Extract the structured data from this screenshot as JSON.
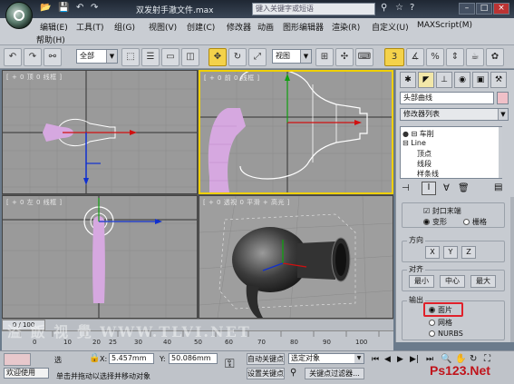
{
  "window": {
    "title": "双发射手澈文件.max",
    "search_placeholder": "键入关键字或短语"
  },
  "menu": {
    "row1": [
      "编辑(E)",
      "工具(T)",
      "组(G)",
      "视图(V)",
      "创建(C)",
      "修改器",
      "动画",
      "图形编辑器",
      "渲染(R)",
      "自定义(U)",
      "MAXScript(M)"
    ],
    "row2": [
      "帮助(H)"
    ]
  },
  "toolbar": {
    "selection_filter": "全部",
    "reference_coord": "视图",
    "snap_value": "3"
  },
  "viewports": {
    "top": "[ + 0 顶 0 线框 ]",
    "front": "[ + 0 前 0 线框 ]",
    "left": "[ + 0 左 0 线框 ]",
    "perspective": "[ + 0 透视 0 平滑 + 高光 ]"
  },
  "panel": {
    "object_name": "头部曲线",
    "modifier_list": "修改器列表",
    "stack": {
      "top": "车削",
      "base": "Line",
      "sub1": "顶点",
      "sub2": "线段",
      "sub3": "样条线"
    },
    "cap_end": "封口末端",
    "morph": "变形",
    "grid": "栅格",
    "direction": {
      "title": "方向",
      "x": "X",
      "y": "Y",
      "z": "Z"
    },
    "align": {
      "title": "对齐",
      "min": "最小",
      "center": "中心",
      "max": "最大"
    },
    "output": {
      "title": "输出",
      "patch": "面片",
      "mesh": "网格",
      "nurbs": "NURBS"
    }
  },
  "timeline": {
    "frame": "0 / 100",
    "ticks": [
      "0",
      "10",
      "20",
      "25",
      "30",
      "40",
      "50",
      "60",
      "70",
      "80",
      "90",
      "100"
    ]
  },
  "status": {
    "welcome": "欢迎使用",
    "selected": "选",
    "prompt": "单击并拖动以选择并移动对象",
    "x_label": "X:",
    "x_value": "5.457mm",
    "y_label": "Y:",
    "y_value": "50.086mm",
    "auto_key": "自动关键点",
    "set_key": "设置关键点",
    "selected_obj": "选定对象",
    "key_filter": "关键点过滤器..."
  },
  "watermark": "溢 飯 视 覺 WWW.TLVI.NET",
  "brand": "Ps123.Net",
  "colors": {
    "accent_active": "#f0d000",
    "highlight_red": "#e0202a",
    "object_pink": "#d6a8e0"
  }
}
